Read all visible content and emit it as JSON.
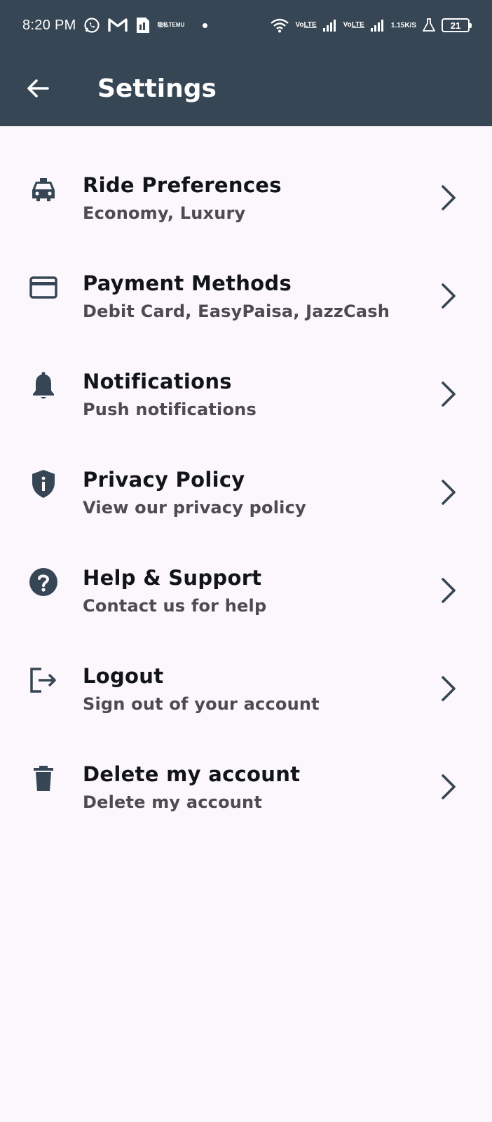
{
  "status_bar": {
    "time": "8:20 PM",
    "temu_label_top": "隐私",
    "temu_label_bottom": "TEMU",
    "volte_1_top": "Vo",
    "volte_1_bottom": "LTE",
    "volte_2_top": "Vo",
    "volte_2_bottom": "LTE",
    "speed_value": "1.15",
    "speed_unit": "K/S",
    "battery": "21",
    "icons": [
      "whatsapp-icon",
      "gmail-icon",
      "sim-icon",
      "temu-icon",
      "wifi-icon",
      "signal-icon",
      "flask-icon",
      "battery-icon"
    ]
  },
  "app_bar": {
    "title": "Settings",
    "back_icon": "arrow-left-icon",
    "background": "#364654"
  },
  "settings": [
    {
      "id": "ride-preferences",
      "icon": "taxi-icon",
      "title": "Ride Preferences",
      "subtitle": "Economy, Luxury"
    },
    {
      "id": "payment-methods",
      "icon": "credit-card-icon",
      "title": "Payment Methods",
      "subtitle": "Debit Card, EasyPaisa, JazzCash"
    },
    {
      "id": "notifications",
      "icon": "bell-icon",
      "title": "Notifications",
      "subtitle": "Push notifications"
    },
    {
      "id": "privacy-policy",
      "icon": "shield-info-icon",
      "title": "Privacy Policy",
      "subtitle": "View our privacy policy"
    },
    {
      "id": "help-support",
      "icon": "help-circle-icon",
      "title": "Help & Support",
      "subtitle": "Contact us for help"
    },
    {
      "id": "logout",
      "icon": "logout-icon",
      "title": "Logout",
      "subtitle": "Sign out of your account"
    },
    {
      "id": "delete-account",
      "icon": "trash-icon",
      "title": "Delete my account",
      "subtitle": "Delete my account"
    }
  ],
  "colors": {
    "accent": "#364654",
    "background": "#FCF7FC",
    "icon": "#364654",
    "title_text": "#111418",
    "subtitle_text": "#4E4A52"
  }
}
